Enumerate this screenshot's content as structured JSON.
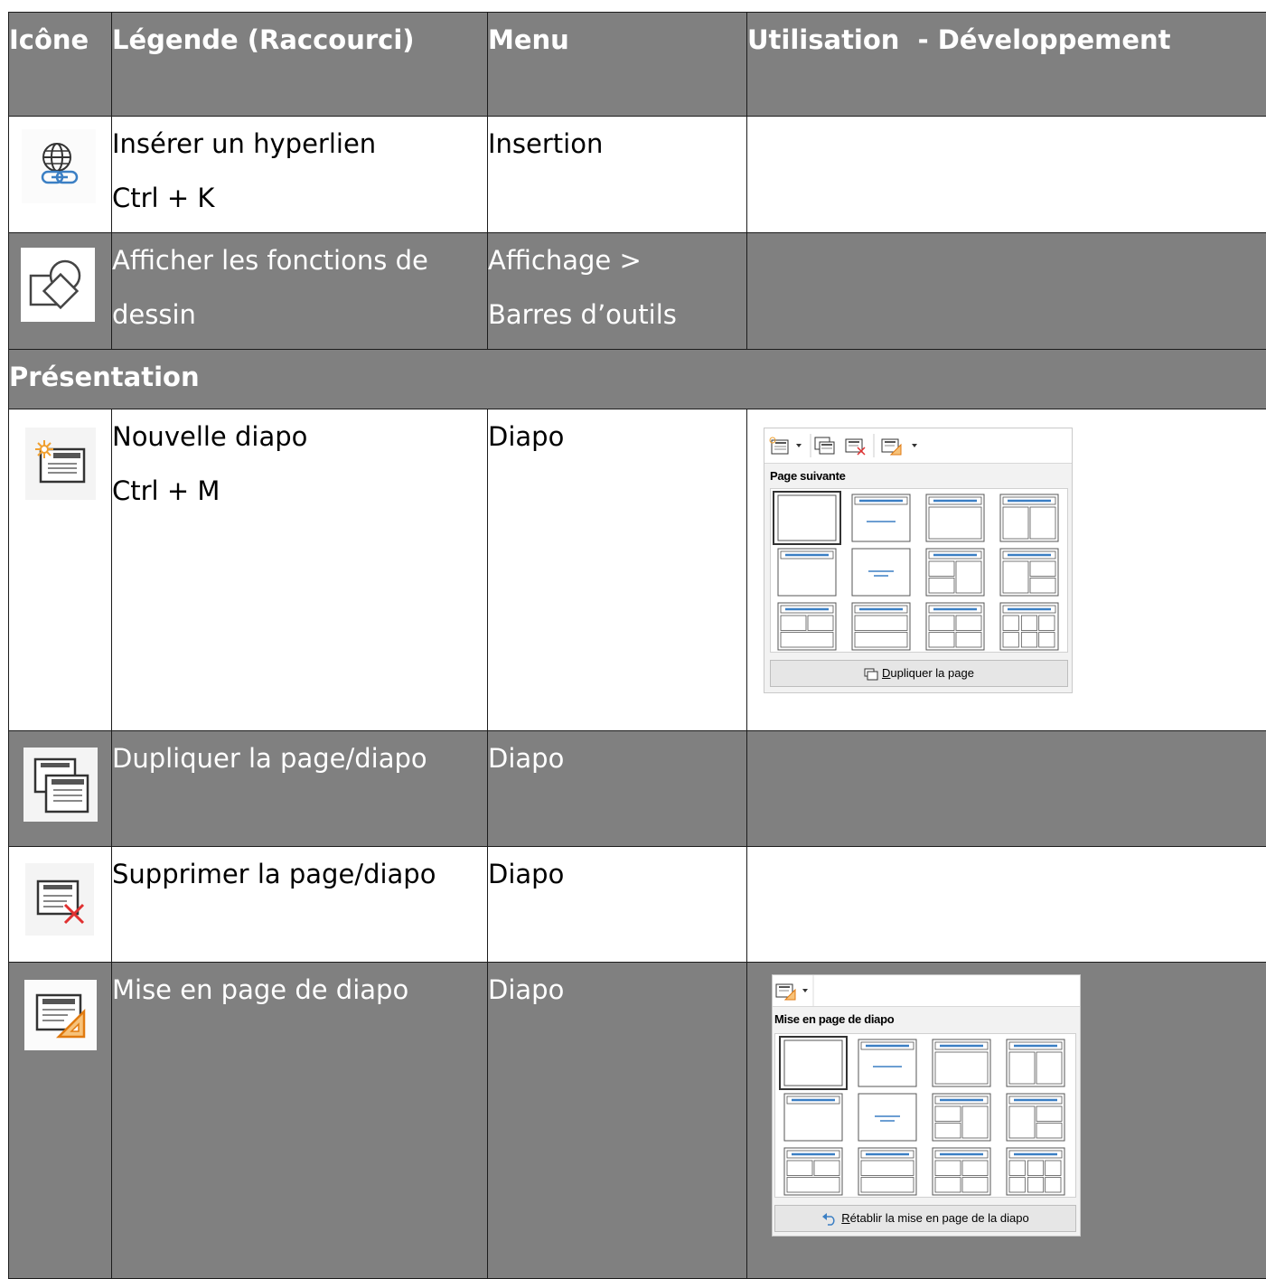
{
  "header": {
    "col_icon": "Icône",
    "col_legend": "Légende (Raccourci)",
    "col_menu": "Menu",
    "col_usage": "Utilisation  - Développement"
  },
  "rows": [
    {
      "icon": "insert-hyperlink-icon",
      "legend": "Insérer un hyperlien",
      "shortcut": "Ctrl + K",
      "menu": "Insertion",
      "menu2": "",
      "usage": ""
    },
    {
      "icon": "show-draw-functions-icon",
      "legend": "Afficher les fonctions de",
      "legend2": "dessin",
      "menu": "Affichage >",
      "menu2": "Barres d’outils",
      "usage": ""
    },
    {
      "section": "Présentation"
    },
    {
      "icon": "new-slide-icon",
      "legend": "Nouvelle diapo",
      "shortcut": "Ctrl + M",
      "menu": "Diapo"
    },
    {
      "icon": "duplicate-slide-icon",
      "legend": "Dupliquer la page/diapo",
      "menu": "Diapo"
    },
    {
      "icon": "delete-slide-icon",
      "legend": "Supprimer la page/diapo",
      "menu": "Diapo"
    },
    {
      "icon": "slide-layout-icon",
      "legend": "Mise en page de diapo",
      "menu": "Diapo"
    }
  ],
  "panel_new_slide": {
    "title": "Page suivante",
    "button_mnemonic": "D",
    "button_rest": "upliquer la page"
  },
  "panel_layout": {
    "title": "Mise en page de diapo",
    "button_mnemonic": "R",
    "button_rest": "établir la mise en page de la diapo"
  },
  "colors": {
    "grey_row": "#808080",
    "accent_blue": "#3b7fc4",
    "accent_orange": "#f0a030",
    "delete_red": "#e03030"
  }
}
